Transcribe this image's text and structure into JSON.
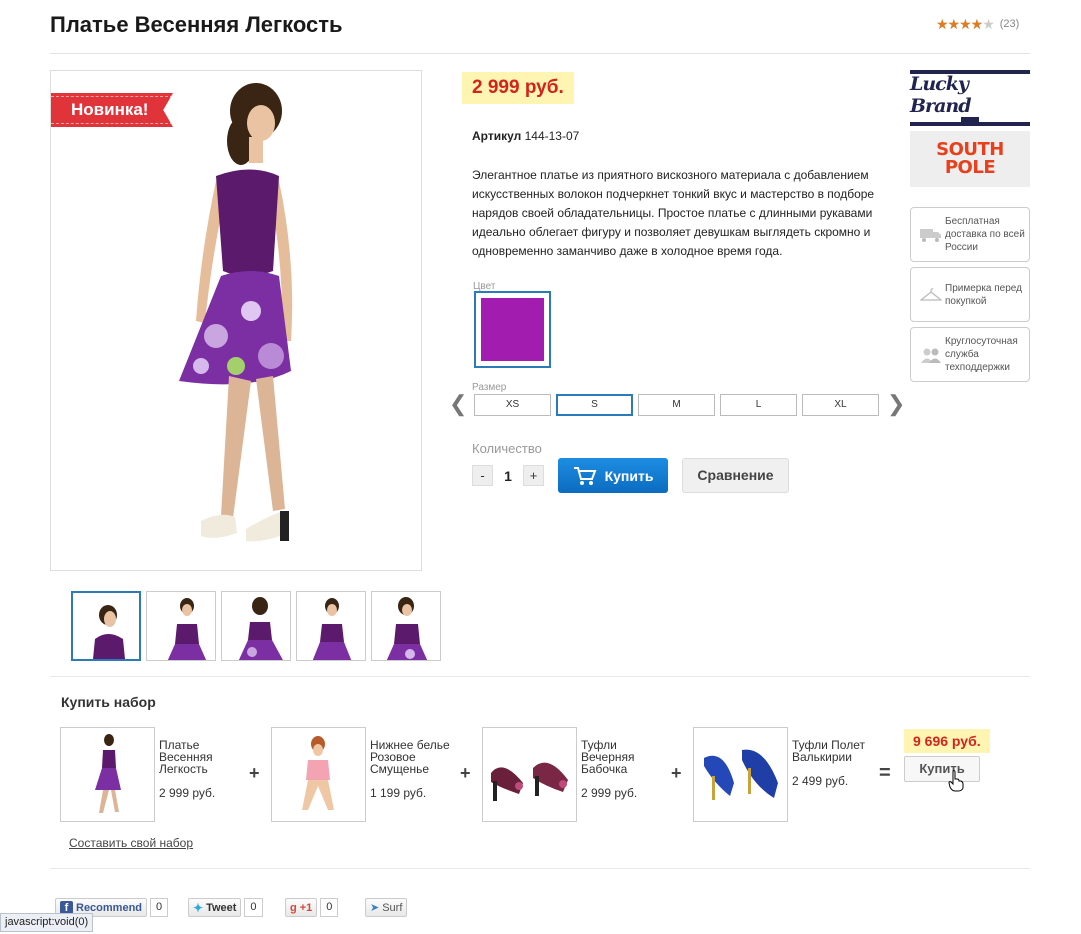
{
  "product": {
    "title": "Платье Весенняя Легкость",
    "rating": 4,
    "rating_max": 5,
    "rating_count": "(23)",
    "badge": "Новинка!",
    "price": "2 999 руб.",
    "article_label": "Артикул",
    "article_value": "144-13-07",
    "description": "Элегантное платье из приятного вискозного материала с добавлением искусственных волокон подчеркнет тонкий вкус и мастерство в подборе нарядов своей обладательницы. Простое платье с длинными рукавами идеально облегает фигуру и позволяет девушкам выглядеть скромно и одновременно заманчиво даже в холодное время года.",
    "color_label": "Цвет",
    "color_value": "#a21caf",
    "size_label": "Размер",
    "sizes": [
      "XS",
      "S",
      "M",
      "L",
      "XL"
    ],
    "selected_size": "S",
    "qty_label": "Количество",
    "qty_minus": "-",
    "qty_value": "1",
    "qty_plus": "+",
    "buy_label": "Купить",
    "compare_label": "Сравнение"
  },
  "brands": {
    "lucky": "Lucky Brand",
    "south_line1": "SOUTH",
    "south_line2": "POLE"
  },
  "services": [
    {
      "icon": "truck-icon",
      "text": "Бесплатная доставка по всей России"
    },
    {
      "icon": "hanger-icon",
      "text": "Примерка перед покупкой"
    },
    {
      "icon": "people-icon",
      "text": "Круглосуточная служба техподдержки"
    }
  ],
  "bundle": {
    "title": "Купить набор",
    "items": [
      {
        "name": "Платье Весенняя Легкость",
        "price": "2 999 руб."
      },
      {
        "name": "Нижнее белье Розовое Смущенье",
        "price": "1 199 руб."
      },
      {
        "name": "Туфли Вечерняя Бабочка",
        "price": "2 999 руб."
      },
      {
        "name": "Туфли Полет Валькирии",
        "price": "2 499 руб."
      }
    ],
    "plus": "+",
    "equals": "=",
    "total": "9 696 руб.",
    "buy_label": "Купить",
    "own_set_link": "Составить свой набор"
  },
  "social": {
    "fb_label": "Recommend",
    "fb_count": "0",
    "tw_label": "Tweet",
    "tw_count": "0",
    "gp_label": "+1",
    "gp_count": "0",
    "surf_label": "Surf"
  },
  "status_bar": "javascript:void(0)",
  "colors": {
    "accent_blue": "#2b7bb8",
    "price_red": "#d2231c",
    "price_bg": "#fff5b3",
    "badge_red": "#e0343a",
    "star_orange": "#e07b20"
  }
}
